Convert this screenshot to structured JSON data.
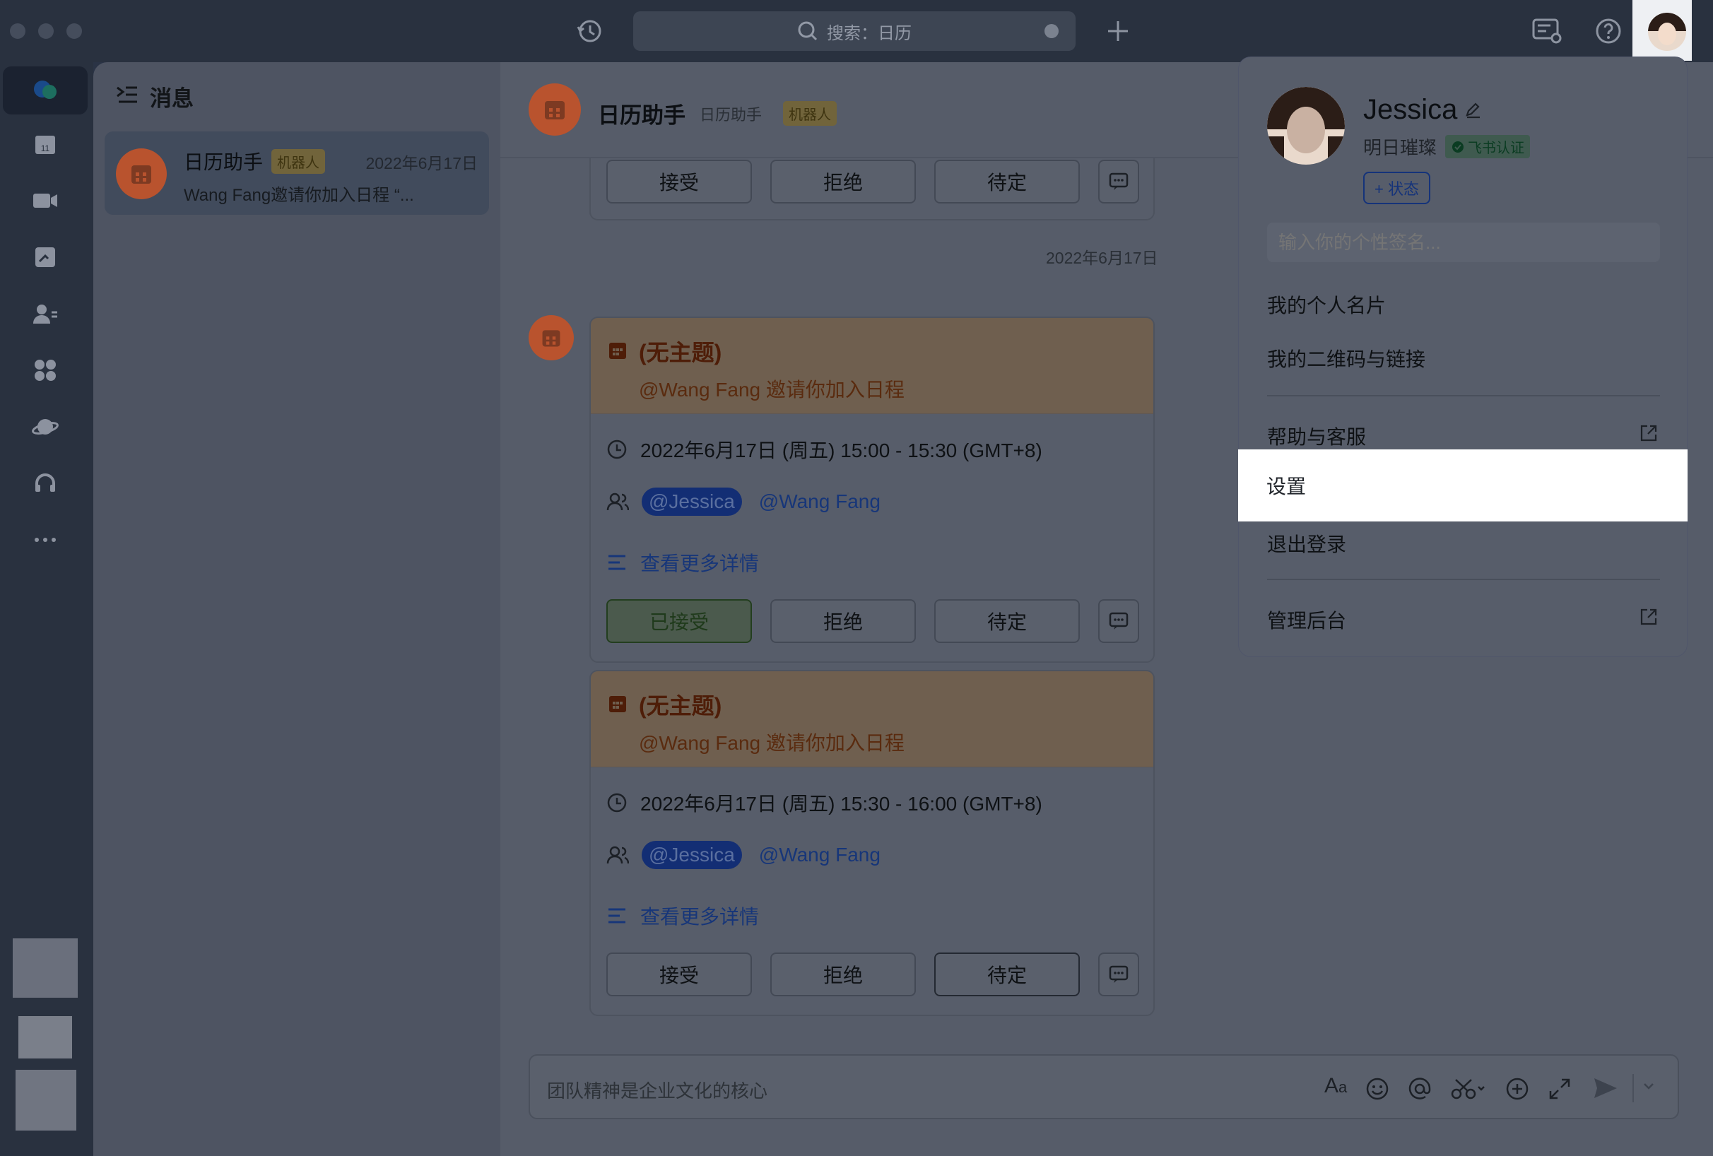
{
  "topbar": {
    "search_label": "搜索：日历"
  },
  "sidebar": {
    "list_title": "消息"
  },
  "chat_list": {
    "item": {
      "name": "日历助手",
      "tag": "机器人",
      "date": "2022年6月17日",
      "preview": "Wang Fang邀请你加入日程 “..."
    }
  },
  "chat": {
    "title": "日历助手",
    "subtitle": "日历助手",
    "tag": "机器人",
    "top_buttons": [
      "接受",
      "拒绝",
      "待定"
    ],
    "date_divider": "2022年6月17日",
    "cards": [
      {
        "title": "(无主题)",
        "invite": "@Wang Fang 邀请你加入日程",
        "time": "2022年6月17日 (周五) 15:00 - 15:30 (GMT+8)",
        "mention_self": "@Jessica",
        "mention_other": "@Wang Fang",
        "more": "查看更多详情",
        "buttons": [
          "已接受",
          "拒绝",
          "待定"
        ]
      },
      {
        "title": "(无主题)",
        "invite": "@Wang Fang 邀请你加入日程",
        "time": "2022年6月17日 (周五) 15:30 - 16:00 (GMT+8)",
        "mention_self": "@Jessica",
        "mention_other": "@Wang Fang",
        "more": "查看更多详情",
        "buttons": [
          "接受",
          "拒绝",
          "待定"
        ]
      }
    ],
    "composer_placeholder": "团队精神是企业文化的核心"
  },
  "profile": {
    "name": "Jessica",
    "org": "明日璀璨",
    "badge": "飞书认证",
    "status_button": "+ 状态",
    "signature_placeholder": "输入你的个性签名...",
    "menu": [
      "我的个人名片",
      "我的二维码与链接",
      "帮助与客服",
      "设置",
      "退出登录",
      "管理后台"
    ]
  },
  "colors": {
    "accent_blue": "#3370ff",
    "bot_orange": "#e8744a",
    "accepted_green": "#34a853"
  }
}
